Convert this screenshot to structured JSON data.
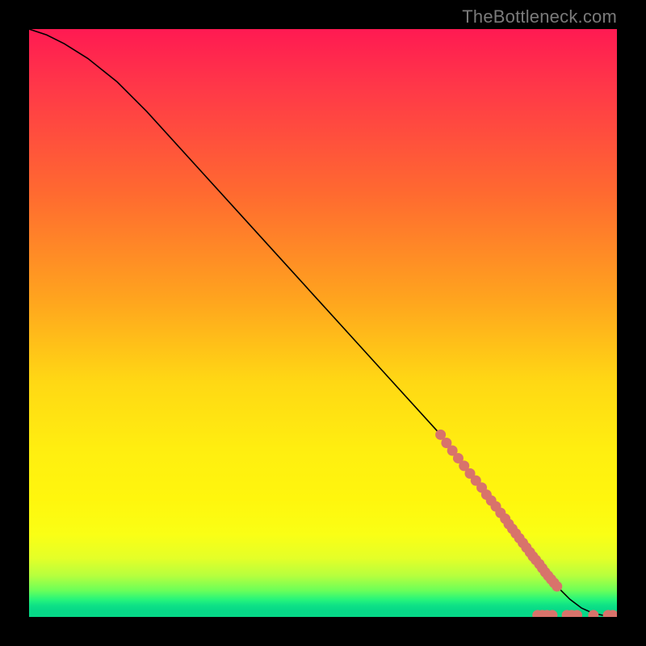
{
  "attribution": "TheBottleneck.com",
  "chart_data": {
    "type": "line",
    "title": "",
    "xlabel": "",
    "ylabel": "",
    "xlim": [
      0,
      100
    ],
    "ylim": [
      0,
      100
    ],
    "curve": {
      "x": [
        0,
        3,
        6,
        10,
        15,
        20,
        30,
        40,
        50,
        60,
        70,
        77,
        82,
        85,
        88,
        90,
        92,
        94,
        96,
        98,
        100
      ],
      "y": [
        100,
        99,
        97.5,
        95,
        91,
        86,
        75,
        64,
        53,
        42,
        31,
        22,
        16,
        12,
        8,
        5,
        3,
        1.5,
        0.6,
        0.2,
        0.1
      ]
    },
    "curve_color": "#000000",
    "markers": {
      "comment": "salmon dot-cluster on the lower-right tail of the curve plus a few along the floor",
      "color": "#d8736b",
      "points": [
        {
          "x": 70.0,
          "y": 31.0
        },
        {
          "x": 71.0,
          "y": 29.6
        },
        {
          "x": 72.0,
          "y": 28.3
        },
        {
          "x": 73.0,
          "y": 27.0
        },
        {
          "x": 74.0,
          "y": 25.7
        },
        {
          "x": 75.0,
          "y": 24.4
        },
        {
          "x": 76.0,
          "y": 23.2
        },
        {
          "x": 77.0,
          "y": 22.0
        },
        {
          "x": 77.8,
          "y": 20.8
        },
        {
          "x": 78.6,
          "y": 19.8
        },
        {
          "x": 79.4,
          "y": 18.8
        },
        {
          "x": 80.2,
          "y": 17.7
        },
        {
          "x": 81.0,
          "y": 16.7
        },
        {
          "x": 81.6,
          "y": 15.8
        },
        {
          "x": 82.2,
          "y": 15.0
        },
        {
          "x": 82.8,
          "y": 14.2
        },
        {
          "x": 83.4,
          "y": 13.4
        },
        {
          "x": 84.0,
          "y": 12.6
        },
        {
          "x": 84.6,
          "y": 11.8
        },
        {
          "x": 85.2,
          "y": 11.0
        },
        {
          "x": 85.7,
          "y": 10.3
        },
        {
          "x": 86.2,
          "y": 9.7
        },
        {
          "x": 86.8,
          "y": 9.0
        },
        {
          "x": 87.3,
          "y": 8.3
        },
        {
          "x": 87.8,
          "y": 7.6
        },
        {
          "x": 88.3,
          "y": 7.0
        },
        {
          "x": 88.8,
          "y": 6.4
        },
        {
          "x": 89.3,
          "y": 5.8
        },
        {
          "x": 89.8,
          "y": 5.2
        },
        {
          "x": 86.5,
          "y": 0.3
        },
        {
          "x": 87.3,
          "y": 0.3
        },
        {
          "x": 88.1,
          "y": 0.3
        },
        {
          "x": 89.0,
          "y": 0.3
        },
        {
          "x": 91.5,
          "y": 0.3
        },
        {
          "x": 92.3,
          "y": 0.3
        },
        {
          "x": 93.2,
          "y": 0.3
        },
        {
          "x": 96.0,
          "y": 0.3
        },
        {
          "x": 98.5,
          "y": 0.3
        },
        {
          "x": 99.3,
          "y": 0.3
        }
      ]
    }
  }
}
